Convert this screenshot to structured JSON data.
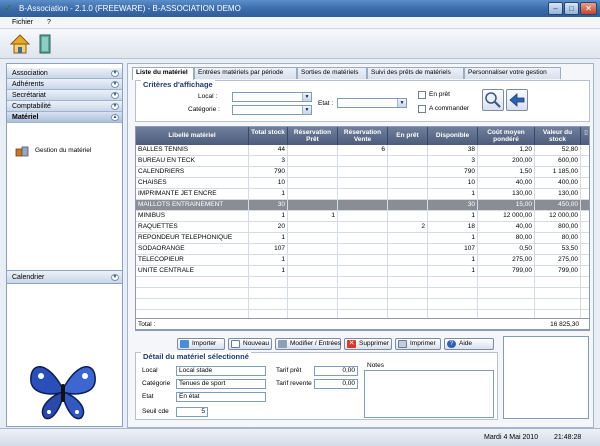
{
  "window": {
    "title": "B-Association - 2.1.0 (FREEWARE) - B-ASSOCIATION DEMO"
  },
  "menu": {
    "items": [
      "Fichier",
      "?"
    ]
  },
  "sidebar": {
    "sections": [
      {
        "label": "Association"
      },
      {
        "label": "Adhérents"
      },
      {
        "label": "Secrétariat"
      },
      {
        "label": "Comptabilité"
      },
      {
        "label": "Matériel"
      }
    ],
    "items": [
      {
        "label": "Gestion du matériel"
      }
    ],
    "bottom_section": "Calendrier"
  },
  "tabs": [
    {
      "label": "Liste du matériel"
    },
    {
      "label": "Entrées matériels par période"
    },
    {
      "label": "Sorties de matériels"
    },
    {
      "label": "Suivi des prêts de matériels"
    },
    {
      "label": "Personnaliser votre gestion"
    }
  ],
  "criteria": {
    "legend": "Critères d'affichage",
    "local_label": "Local :",
    "categorie_label": "Catégorie :",
    "etat_label": "Etat :",
    "en_pret_label": "En prêt",
    "a_commander_label": "A commander"
  },
  "table": {
    "columns": [
      "Libellé matériel",
      "Total stock",
      "Réservation Prêt",
      "Réservation Vente",
      "En prêt",
      "Disponible",
      "Coût moyen pondéré",
      "Valeur du stock"
    ],
    "rows": [
      [
        "BALLES TENNIS",
        "44",
        "",
        "6",
        "",
        "38",
        "1,20",
        "52,80"
      ],
      [
        "BUREAU EN TECK",
        "3",
        "",
        "",
        "",
        "3",
        "200,00",
        "600,00"
      ],
      [
        "CALENDRIERS",
        "790",
        "",
        "",
        "",
        "790",
        "1,50",
        "1 185,00"
      ],
      [
        "CHAISES",
        "10",
        "",
        "",
        "",
        "10",
        "40,00",
        "400,00"
      ],
      [
        "IMPRIMANTE JET ENCRE",
        "1",
        "",
        "",
        "",
        "1",
        "130,00",
        "130,00"
      ],
      [
        "MAILLOTS ENTRAINEMENT",
        "30",
        "",
        "",
        "",
        "30",
        "15,00",
        "450,00"
      ],
      [
        "MINIBUS",
        "1",
        "1",
        "",
        "",
        "1",
        "12 000,00",
        "12 000,00"
      ],
      [
        "RAQUETTES",
        "20",
        "",
        "",
        "2",
        "18",
        "40,00",
        "800,00"
      ],
      [
        "REPONDEUR TELEPHONIQUE",
        "1",
        "",
        "",
        "",
        "1",
        "80,00",
        "80,00"
      ],
      [
        "SODAORANGE",
        "107",
        "",
        "",
        "",
        "107",
        "0,50",
        "53,50"
      ],
      [
        "TELECOPIEUR",
        "1",
        "",
        "",
        "",
        "1",
        "275,00",
        "275,00"
      ],
      [
        "UNITE CENTRALE",
        "1",
        "",
        "",
        "",
        "1",
        "799,00",
        "799,00"
      ]
    ],
    "selected_row": 5,
    "total_label": "Total :",
    "total_value": "16 825,30"
  },
  "actions": [
    "Importer",
    "Nouveau",
    "Modifier / Entrées",
    "Supprimer",
    "Imprimer",
    "Aide"
  ],
  "detail": {
    "legend": "Détail du matériel sélectionné",
    "local_label": "Local",
    "local_value": "Local stade",
    "categorie_label": "Catégorie",
    "categorie_value": "Tenues de sport",
    "etat_label": "Etat",
    "etat_value": "En état",
    "seuil_label": "Seuil cde",
    "seuil_value": "5",
    "tarif_pret_label": "Tarif prêt",
    "tarif_pret_value": "0,00",
    "tarif_revente_label": "Tarif revente",
    "tarif_revente_value": "0,00",
    "notes_label": "Notes"
  },
  "status": {
    "date": "Mardi 4 Mai 2010",
    "time": "21:48:28"
  },
  "colors": {
    "title_bar": "#3a6aa8",
    "header_bg": "#5d6c89",
    "selected_row": "#8a8d93"
  }
}
